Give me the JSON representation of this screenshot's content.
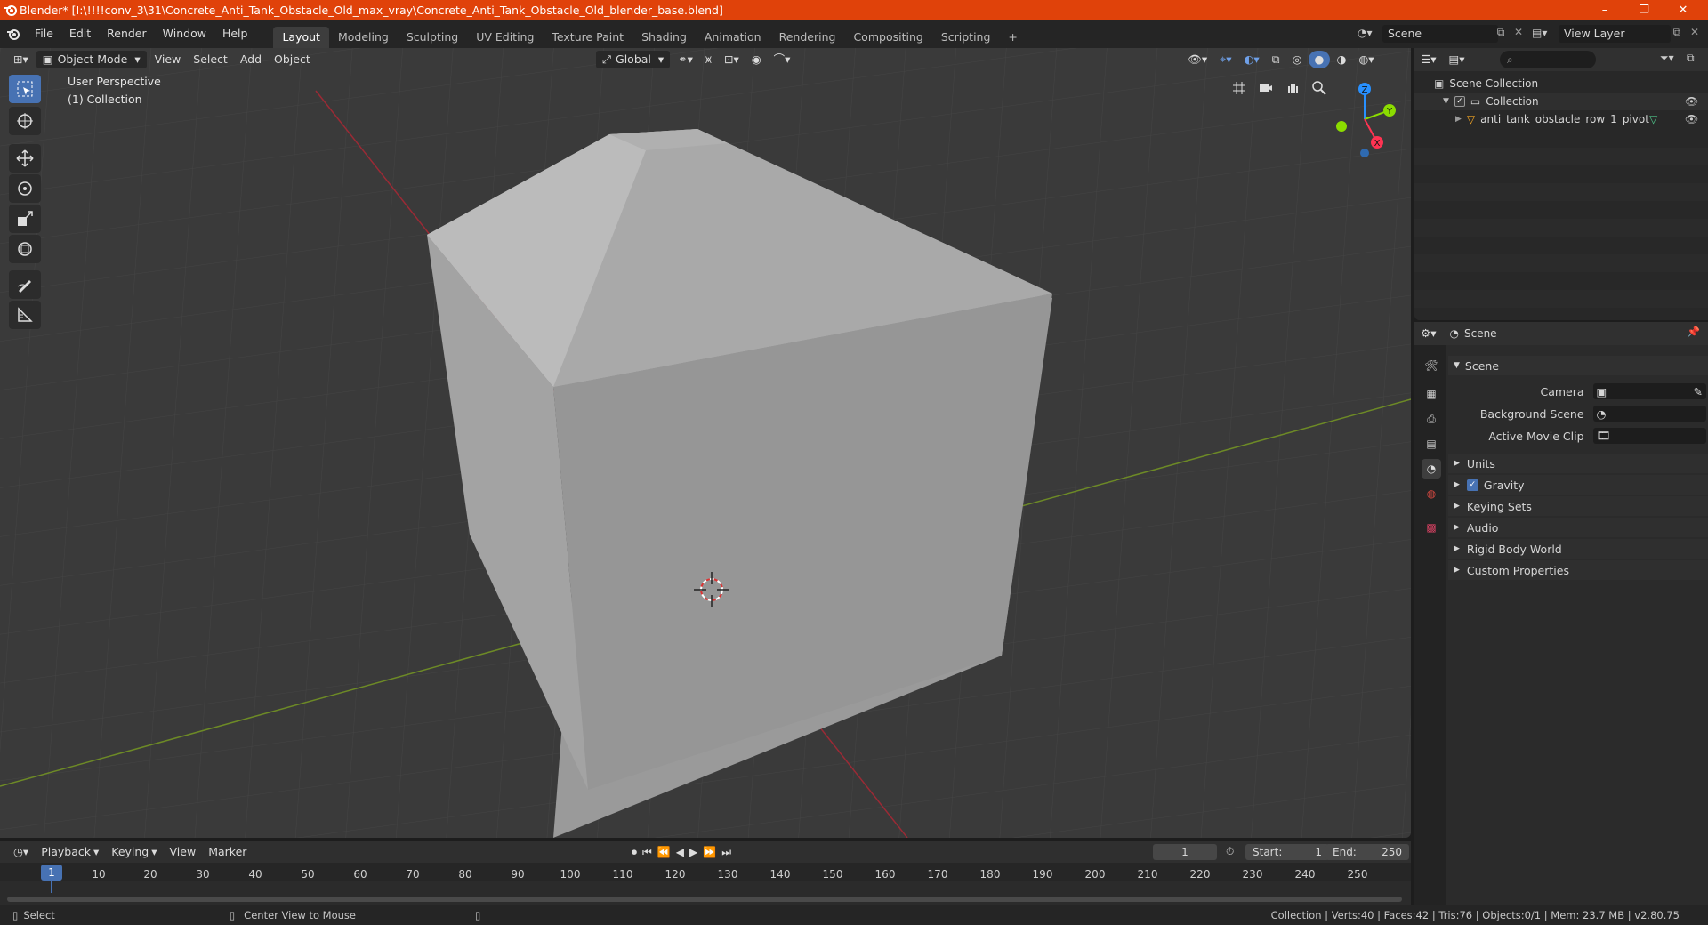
{
  "window": {
    "title": "Blender* [I:\\!!!!conv_3\\31\\Concrete_Anti_Tank_Obstacle_Old_max_vray\\Concrete_Anti_Tank_Obstacle_Old_blender_base.blend]",
    "minimize": "–",
    "maximize": "❐",
    "close": "✕"
  },
  "menu": [
    "File",
    "Edit",
    "Render",
    "Window",
    "Help"
  ],
  "workspaces": [
    "Layout",
    "Modeling",
    "Sculpting",
    "UV Editing",
    "Texture Paint",
    "Shading",
    "Animation",
    "Rendering",
    "Compositing",
    "Scripting"
  ],
  "workspace_active": "Layout",
  "add_workspace": "+",
  "scene": {
    "name": "Scene"
  },
  "view_layer": {
    "name": "View Layer"
  },
  "viewport": {
    "mode": "Object Mode",
    "menus": [
      "View",
      "Select",
      "Add",
      "Object"
    ],
    "orientation": "Global",
    "perspective": "User Perspective",
    "collection": "(1) Collection",
    "gizmo": {
      "z": "Z",
      "y": "Y",
      "x": "X"
    }
  },
  "outliner": {
    "root": "Scene Collection",
    "collection": "Collection",
    "object": "anti_tank_obstacle_row_1_pivot"
  },
  "properties": {
    "header": "Scene",
    "panel": "Scene",
    "fields": [
      {
        "label": "Camera"
      },
      {
        "label": "Background Scene"
      },
      {
        "label": "Active Movie Clip"
      }
    ],
    "sections": [
      "Units",
      "Gravity",
      "Keying Sets",
      "Audio",
      "Rigid Body World",
      "Custom Properties"
    ],
    "gravity_checked": true
  },
  "timeline": {
    "menus": [
      "Playback",
      "Keying",
      "View",
      "Marker"
    ],
    "current_frame": "1",
    "start_label": "Start:",
    "start": "1",
    "end_label": "End:",
    "end": "250",
    "ticks": [
      "10",
      "20",
      "30",
      "40",
      "50",
      "60",
      "70",
      "80",
      "90",
      "100",
      "110",
      "120",
      "130",
      "140",
      "150",
      "160",
      "170",
      "180",
      "190",
      "200",
      "210",
      "220",
      "230",
      "240",
      "250"
    ],
    "cursor_frame": "1"
  },
  "status": {
    "select": "Select",
    "center": "Center View to Mouse",
    "stats": "Collection | Verts:40 | Faces:42 | Tris:76 | Objects:0/1 | Mem: 23.7 MB | v2.80.75"
  },
  "colors": {
    "titlebar": "#e0420a",
    "accent": "#4772b3",
    "axis_x": "#ff3352",
    "axis_y": "#8bdc00",
    "axis_z": "#2890ff"
  }
}
